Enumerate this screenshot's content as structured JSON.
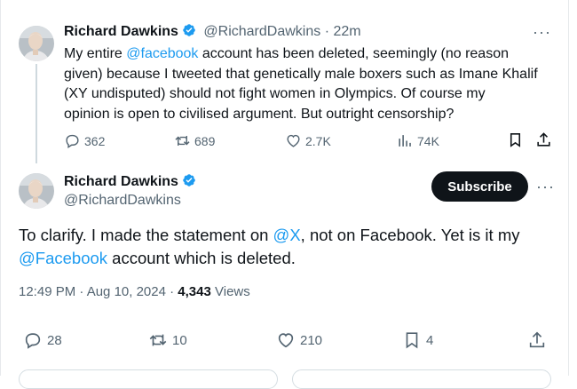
{
  "tweet1": {
    "author_name": "Richard Dawkins",
    "handle": "@RichardDawkins",
    "separator": "·",
    "time": "22m",
    "text_lines": [
      [
        "My entire ",
        "@facebook",
        " account has been deleted, seemingly (no reason"
      ],
      [
        "given) because I tweeted that genetically male boxers such as Imane Khalif"
      ],
      [
        "(XY undisputed) should not fight women in Olympics. Of course  my"
      ],
      [
        "opinion is open to civilised argument. But outright censorship?"
      ]
    ],
    "replies": "362",
    "reposts": "689",
    "likes": "2.7K",
    "views": "74K"
  },
  "tweet2": {
    "author_name": "Richard Dawkins",
    "handle": "@RichardDawkins",
    "subscribe_label": "Subscribe",
    "text": {
      "part1": "To clarify. I made the  statement on ",
      "mention1": "@X",
      "part2": ",  not on Facebook. Yet is it my",
      "mention2": "@Facebook",
      "part3": " account which is deleted."
    },
    "timestamp": "12:49 PM · Aug 10, 2024 ·",
    "views_count": "4,343",
    "views_label": "Views",
    "replies": "28",
    "reposts": "10",
    "likes": "210",
    "bookmarks": "4"
  },
  "colors": {
    "accent": "#1d9bf0",
    "text": "#0f1419",
    "muted": "#536471",
    "verified": "#1d9bf0"
  },
  "icons": [
    "avatar",
    "verified-badge-icon",
    "more-icon",
    "reply-icon",
    "repost-icon",
    "like-icon",
    "views-icon",
    "bookmark-icon",
    "share-icon"
  ]
}
